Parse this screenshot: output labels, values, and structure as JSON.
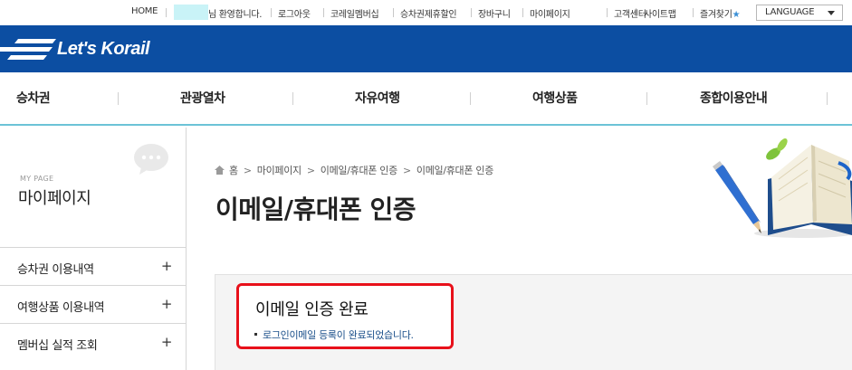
{
  "topbar": {
    "home": "HOME",
    "welcome_suffix": "님 환영합니다.",
    "logout": "로그아웃",
    "membership": "코레일멤버십",
    "ticket_partner_discount": "승차권제휴할인",
    "cart": "장바구니",
    "mypage": "마이페이지",
    "customer_center": "고객센터",
    "sitemap": "사이트맵",
    "favorites": "즐겨찾기",
    "language": "LANGUAGE"
  },
  "header": {
    "logo_text": "Let's Korail"
  },
  "gnb": {
    "items": [
      "승차권",
      "관광열차",
      "자유여행",
      "여행상품",
      "종합이용안내"
    ]
  },
  "sidebar": {
    "small_label": "MY PAGE",
    "title": "마이페이지",
    "items": [
      {
        "label": "승차권 이용내역"
      },
      {
        "label": "여행상품 이용내역"
      },
      {
        "label": "멤버십 실적 조회"
      }
    ]
  },
  "breadcrumb": [
    "홈",
    "마이페이지",
    "이메일/휴대폰 인증",
    "이메일/휴대폰 인증"
  ],
  "main": {
    "page_title": "이메일/휴대폰 인증",
    "notice_title": "이메일 인증 완료",
    "notice_text": "로그인이메일 등록이 완료되었습니다."
  },
  "colors": {
    "brand_blue": "#0c4ea2",
    "accent_line": "#6cc3d7",
    "highlight_red": "#e8101a",
    "link_blue": "#1a4f8a"
  }
}
